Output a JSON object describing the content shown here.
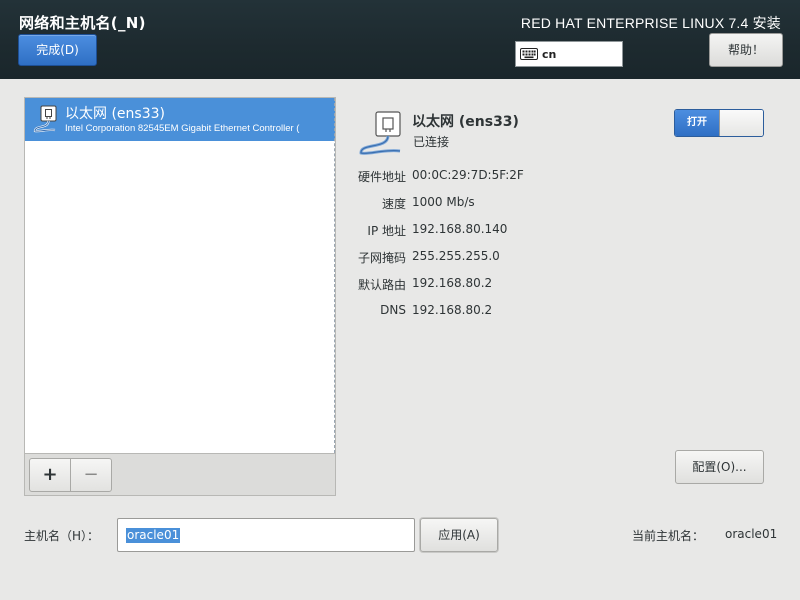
{
  "header": {
    "page_title": "网络和主机名(_N)",
    "done_label": "完成(D)",
    "product_title": "RED HAT ENTERPRISE LINUX 7.4 安装",
    "keyboard_layout": "cn",
    "help_label": "帮助！"
  },
  "device_list": {
    "items": [
      {
        "name": "以太网 (ens33)",
        "description": "Intel Corporation 82545EM Gigabit Ethernet Controller (",
        "selected": true
      }
    ],
    "add_label": "+",
    "remove_label": "−"
  },
  "details": {
    "name": "以太网 (ens33)",
    "status": "已连接",
    "toggle_label": "打开",
    "toggle_on": true,
    "properties": [
      {
        "label": "硬件地址",
        "value": "00:0C:29:7D:5F:2F"
      },
      {
        "label": "速度",
        "value": "1000 Mb/s"
      },
      {
        "label": "IP 地址",
        "value": "192.168.80.140"
      },
      {
        "label": "子网掩码",
        "value": "255.255.255.0"
      },
      {
        "label": "默认路由",
        "value": "192.168.80.2"
      },
      {
        "label": "DNS",
        "value": "192.168.80.2"
      }
    ],
    "configure_label": "配置(O)..."
  },
  "hostname": {
    "label": "主机名（H）：",
    "value": "oracle01",
    "apply_label": "应用(A)",
    "current_label": "当前主机名：",
    "current_value": "oracle01"
  },
  "colors": {
    "header_bg": "#1d2a2f",
    "accent": "#4a90d9",
    "page_bg": "#e8e8e7"
  },
  "icons": {
    "keyboard": "keyboard-icon",
    "network": "ethernet-cable-icon"
  }
}
